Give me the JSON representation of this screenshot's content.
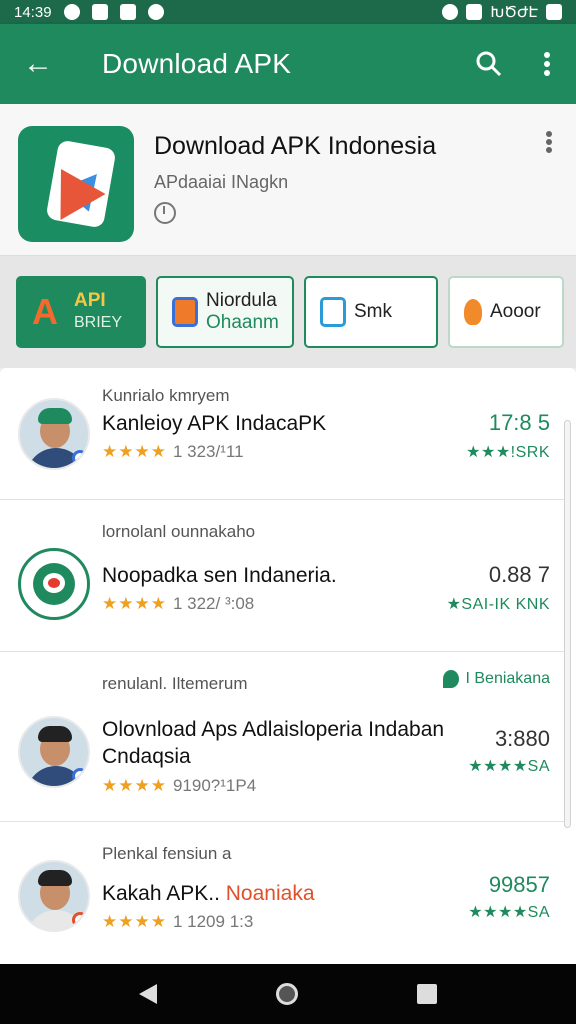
{
  "status_bar": {
    "time": "14:39",
    "right_text": "ԽԾԺԷ"
  },
  "app_bar": {
    "title": "Download APK",
    "back_icon": "arrow-left-icon",
    "search_icon": "search-icon",
    "more_icon": "more-vert-icon"
  },
  "hero": {
    "title": "Download APK Indonesia",
    "subtitle": "APdaaiai INagkn"
  },
  "chips": [
    {
      "line1": "API",
      "line2": "BRIEY"
    },
    {
      "line1": "Niordula",
      "line2": "Ohaanm"
    },
    {
      "line1": "Smk",
      "line2": ""
    },
    {
      "line1": "Aooor",
      "line2": ""
    }
  ],
  "items": [
    {
      "category": "Kunrialo kmryem",
      "name": "Kanleioy APK IndacaPK",
      "rating": "★★★★",
      "count": "1 323/¹11",
      "value": "17:8 5",
      "sub": "★★★!SRK"
    },
    {
      "category": "lornolanl ounnakaho",
      "name": "Noopadka sen Indaneria.",
      "rating": "★★★★",
      "count": "1 322/ ³:08",
      "value": "0.88 7",
      "sub": "★SAI-IK KNK"
    },
    {
      "category": "renulanl. Iltemerum",
      "tag": "I Beniakana",
      "name_line1": "Olovnload Aps Adlaisloperia Indaban",
      "name_line2": "Cndaqsia",
      "rating": "★★★★",
      "count": "9190?¹1P4",
      "value": "3:880",
      "sub": "★★★★SA"
    },
    {
      "category": "Plenkal fensiun a",
      "name_plain": "Kakah APK..",
      "name_highlight": "Noaniaka",
      "rating": "★★★★",
      "count": "1 1209 1:3",
      "value": "99857",
      "sub": "★★★★SA"
    }
  ],
  "colors": {
    "primary": "#1e8a5e",
    "status": "#1c6a4a",
    "star": "#f0a020",
    "highlight": "#e0502a"
  }
}
